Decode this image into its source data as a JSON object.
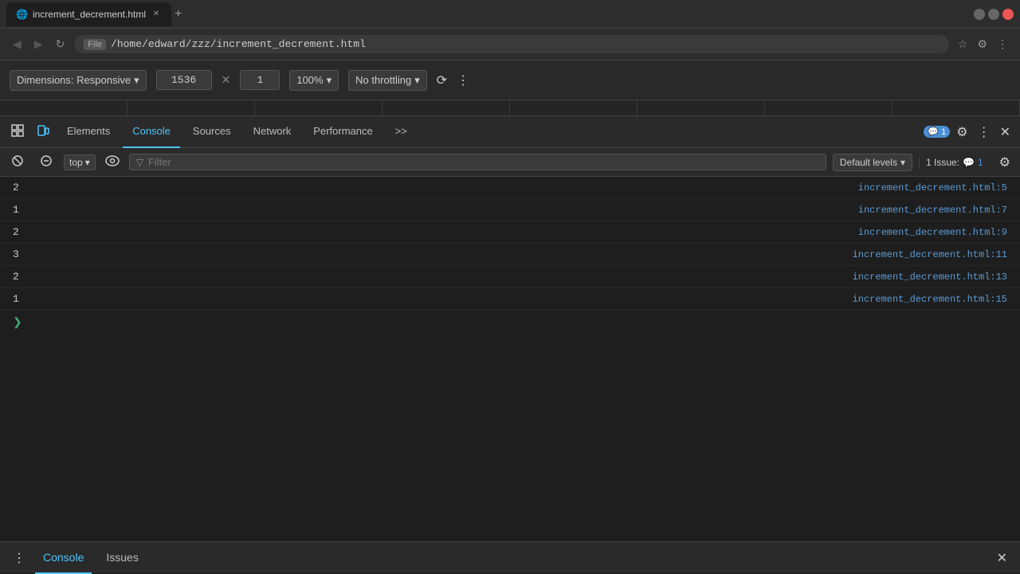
{
  "browser": {
    "tab_title": "increment_decrement.html",
    "address": "/home/edward/zzz/increment_decrement.html",
    "file_label": "File"
  },
  "devtools_responsive": {
    "dimensions_label": "Dimensions: Responsive",
    "width": "1536",
    "height": "1",
    "zoom": "100%",
    "throttle": "No throttling"
  },
  "devtools_tabs": {
    "items": [
      {
        "label": "Elements",
        "active": false
      },
      {
        "label": "Console",
        "active": true
      },
      {
        "label": "Sources",
        "active": false
      },
      {
        "label": "Network",
        "active": false
      },
      {
        "label": "Performance",
        "active": false
      }
    ],
    "more_label": ">>",
    "message_count": "1",
    "settings_label": "⚙",
    "more_btn_label": "⋮",
    "close_label": "✕"
  },
  "console_toolbar": {
    "context": "top",
    "filter_placeholder": "Filter",
    "levels": "Default levels",
    "issues_label": "1 Issue:",
    "issues_count": "1"
  },
  "console_rows": [
    {
      "value": "2",
      "source": "increment_decrement.html:5"
    },
    {
      "value": "1",
      "source": "increment_decrement.html:7"
    },
    {
      "value": "2",
      "source": "increment_decrement.html:9"
    },
    {
      "value": "3",
      "source": "increment_decrement.html:11"
    },
    {
      "value": "2",
      "source": "increment_decrement.html:13"
    },
    {
      "value": "1",
      "source": "increment_decrement.html:15"
    }
  ],
  "bottom_bar": {
    "tabs": [
      {
        "label": "Console",
        "active": true
      },
      {
        "label": "Issues",
        "active": false
      }
    ],
    "close_label": "✕"
  }
}
